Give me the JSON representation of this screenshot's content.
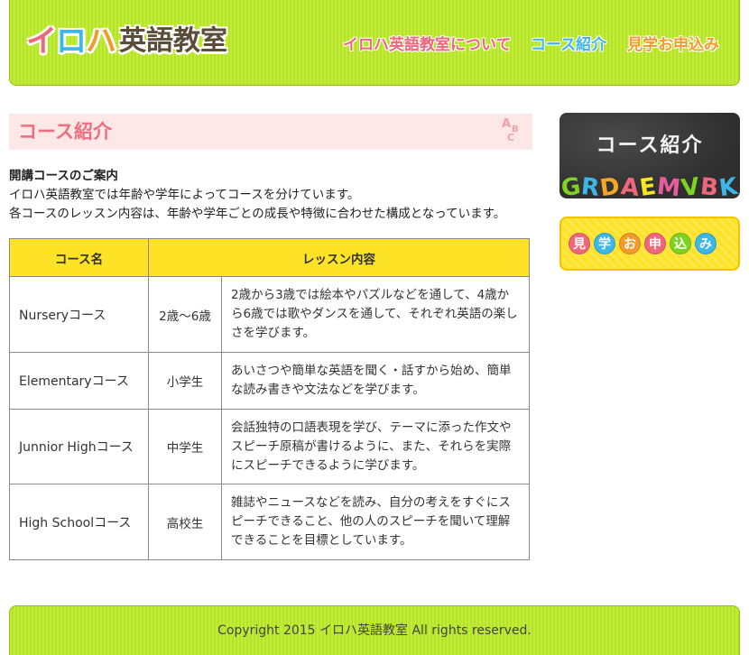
{
  "header": {
    "logo": {
      "kana": [
        "イ",
        "ロ",
        "ハ"
      ],
      "kanji": "英語教室"
    },
    "nav": {
      "about": "イロハ英語教室について",
      "course": "コース紹介",
      "apply": "見学お申込み"
    }
  },
  "main": {
    "title": "コース紹介",
    "title_icon": "abc-icon",
    "intro": {
      "heading": "開講コースのご案内",
      "lines": [
        "イロハ英語教室では年齢や学年によってコースを分けています。",
        "各コースのレッスン内容は、年齢や学年ごとの成長や特徴に合わせた構成となっています。"
      ]
    },
    "table": {
      "headers": [
        "コース名",
        "レッスン内容"
      ],
      "rows": [
        {
          "name": "Nurseryコース",
          "target": "2歳～6歳",
          "description": "2歳から3歳では絵本やパズルなどを通して、4歳から6歳では歌やダンスを通して、それぞれ英語の楽しさを学びます。"
        },
        {
          "name": "Elementaryコース",
          "target": "小学生",
          "description": "あいさつや簡単な英語を聞く・話すから始め、簡単な読み書きや文法などを学びます。"
        },
        {
          "name": "Junnior Highコース",
          "target": "中学生",
          "description": "会話独特の口語表現を学び、テーマに添った作文やスピーチ原稿が書けるように、また、それらを実際にスピーチできるように学びます。"
        },
        {
          "name": "High Schoolコース",
          "target": "高校生",
          "description": "雑誌やニュースなどを読み、自分の考えをすぐにスピーチできること、他の人のスピーチを聞いて理解できることを目標としています。"
        }
      ]
    }
  },
  "sidebar": {
    "course_banner": {
      "label": "コース紹介",
      "letters": [
        {
          "char": "G",
          "color": "#7ed321"
        },
        {
          "char": "R",
          "color": "#3bb7e8"
        },
        {
          "char": "D",
          "color": "#f5a623"
        },
        {
          "char": "A",
          "color": "#f0667a"
        },
        {
          "char": "E",
          "color": "#f8e71c"
        },
        {
          "char": "M",
          "color": "#e85d9b"
        },
        {
          "char": "V",
          "color": "#7ed321"
        },
        {
          "char": "B",
          "color": "#f0667a"
        },
        {
          "char": "K",
          "color": "#3bb7e8"
        }
      ]
    },
    "apply_banner": {
      "chars": [
        {
          "char": "見",
          "color": "#f0667a"
        },
        {
          "char": "学",
          "color": "#3bb7e8"
        },
        {
          "char": "お",
          "color": "#f29b2d"
        },
        {
          "char": "申",
          "color": "#f0667a"
        },
        {
          "char": "込",
          "color": "#7ed321"
        },
        {
          "char": "み",
          "color": "#3bb7e8"
        }
      ]
    }
  },
  "footer": {
    "copyright": "Copyright 2015 イロハ英語教室 All rights reserved."
  },
  "colors": {
    "header_green": "#b5e61d",
    "title_pink": "#ef6e7e",
    "title_bg": "#fde7e7",
    "table_header_yellow": "#fde226"
  }
}
